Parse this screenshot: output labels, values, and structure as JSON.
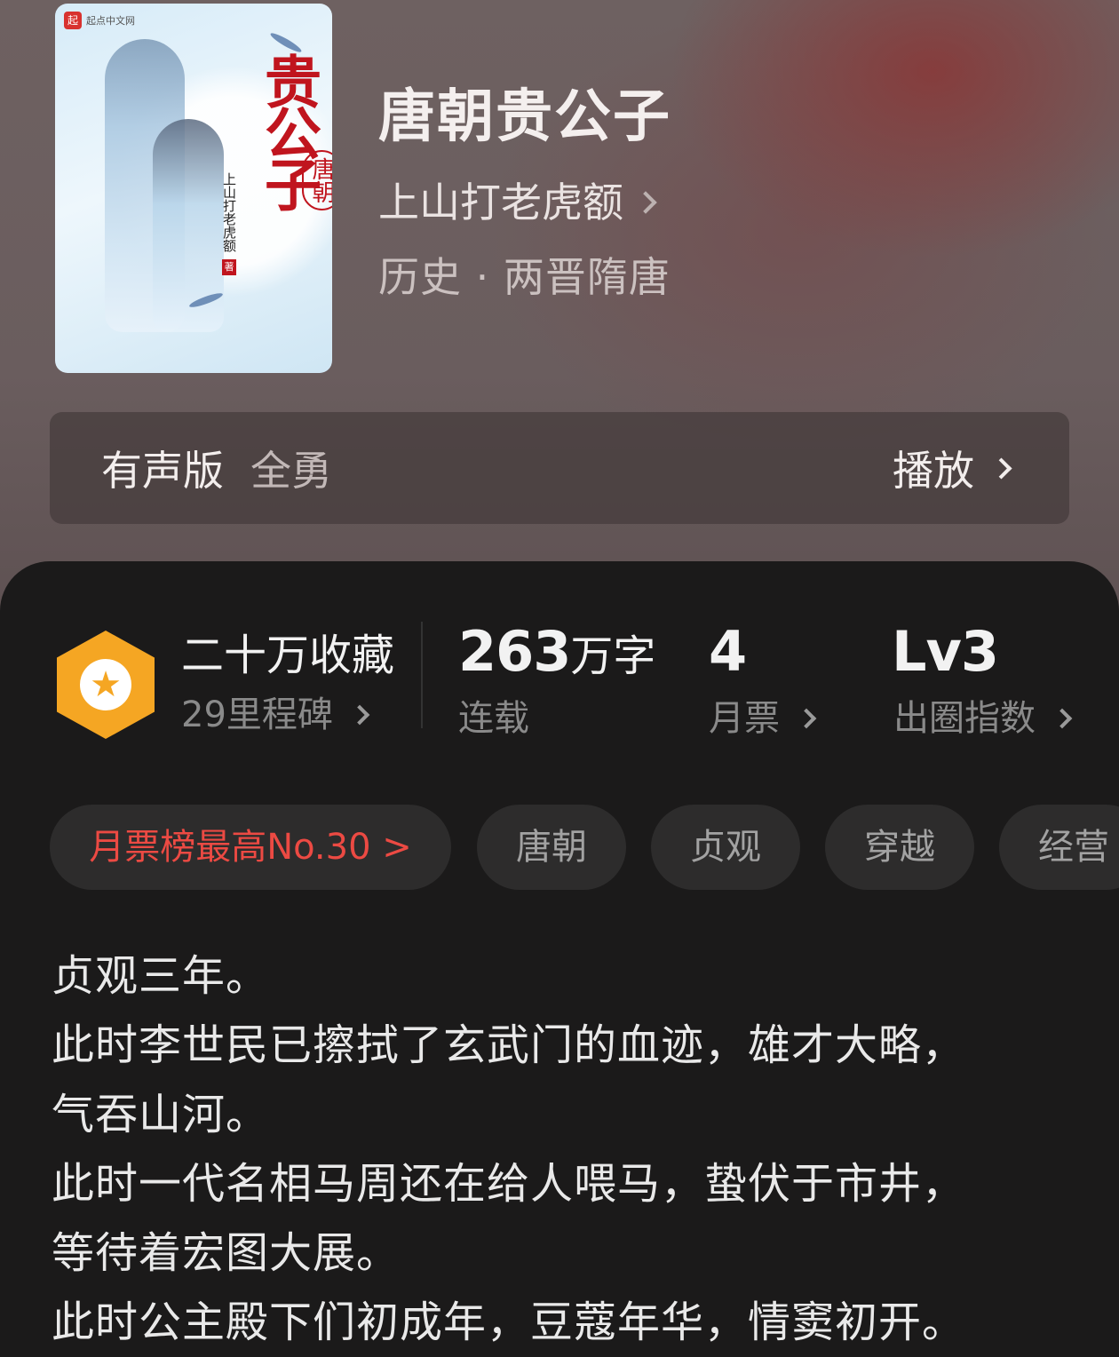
{
  "book": {
    "title": "唐朝贵公子",
    "author": "上山打老虎额",
    "genre": "历史 · 两晋隋唐",
    "cover": {
      "publisher": "起点中文网",
      "publisher_mark": "起",
      "title": "贵公子",
      "subtitle": "唐朝",
      "author": "上山打老虎额",
      "seal": "著"
    }
  },
  "audio": {
    "label": "有声版",
    "narrator": "全勇",
    "play_label": "播放"
  },
  "stats": {
    "collection": {
      "title": "二十万收藏",
      "sub": "29里程碑"
    },
    "words": {
      "value": "263",
      "unit": "万字",
      "sub": "连载"
    },
    "tickets": {
      "value": "4",
      "sub": "月票"
    },
    "level": {
      "value": "Lv3",
      "sub": "出圈指数"
    }
  },
  "tags": [
    "月票榜最高No.30 >",
    "唐朝",
    "贞观",
    "穿越",
    "经营"
  ],
  "description": [
    "贞观三年。",
    "此时李世民已擦拭了玄武门的血迹，雄才大略，",
    "气吞山河。",
    "此时一代名相马周还在给人喂马，蛰伏于市井，",
    "等待着宏图大展。",
    "此时公主殿下们初成年，豆蔻年华，情窦初开。"
  ],
  "colors": {
    "accent_rank": "#ec4a43",
    "badge": "#f5a623",
    "sheet_bg": "#1b1a1a"
  }
}
